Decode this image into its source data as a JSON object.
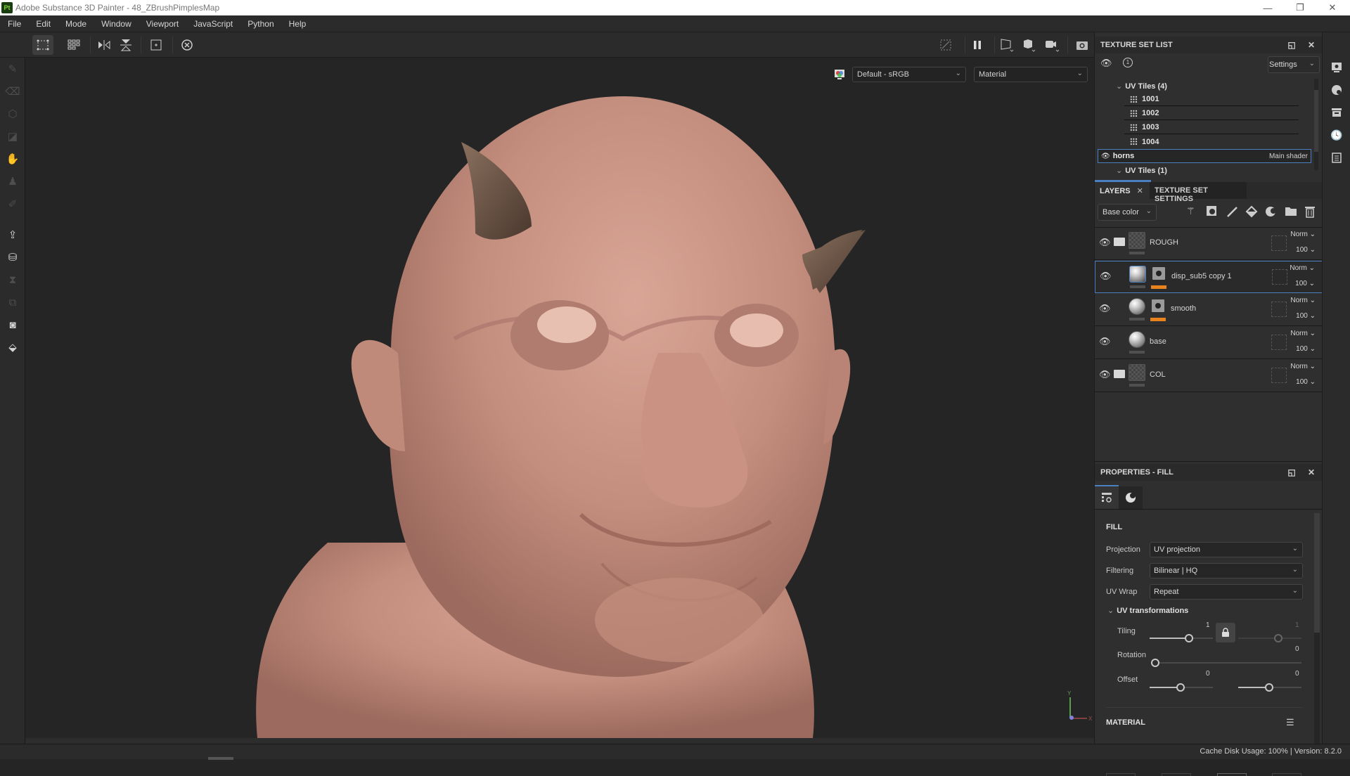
{
  "app": {
    "logo": "Pt",
    "title": "Adobe Substance 3D Painter - 48_ZBrushPimplesMap",
    "window_controls": {
      "minimize": "—",
      "maximize": "❐",
      "close": "✕"
    }
  },
  "menu": [
    "File",
    "Edit",
    "Mode",
    "Window",
    "Viewport",
    "JavaScript",
    "Python",
    "Help"
  ],
  "toolbar": {
    "left_icons": [
      "selection-mode-icon",
      "uv-tile-grid-icon",
      "symmetry-x-icon",
      "symmetry-y-icon",
      "center-view-icon",
      "history-reset-icon"
    ],
    "right_icons": [
      "hide-overlay-icon",
      "pause-icon",
      "display-mode-icon",
      "object-view-icon",
      "camera-icon",
      "screenshot-icon"
    ]
  },
  "left_tools": [
    "paint-brush",
    "eraser",
    "projection",
    "polygon-fill",
    "smudge",
    "clone-stamp",
    "color-picker",
    "export",
    "bake",
    "timeline",
    "transform",
    "sample",
    "geometry-mask"
  ],
  "viewport": {
    "color_profile": "Default - sRGB",
    "display_channel": "Material",
    "axis": {
      "y": "Y",
      "x": "X"
    }
  },
  "texture_set_list": {
    "title": "TEXTURE SET LIST",
    "settings_label": "Settings",
    "groups": [
      {
        "label": "UV Tiles (4)",
        "tiles": [
          "1001",
          "1002",
          "1003",
          "1004"
        ]
      }
    ],
    "selected_set": {
      "name": "horns",
      "shader": "Main shader"
    },
    "next_group": "UV Tiles (1)"
  },
  "layers_panel": {
    "tabs": [
      "LAYERS",
      "TEXTURE SET SETTINGS"
    ],
    "channel": "Base color",
    "tools": [
      "add-effect",
      "add-mask",
      "add-paint-layer",
      "add-fill-layer",
      "add-smart-material",
      "add-folder",
      "delete"
    ],
    "layers": [
      {
        "name": "ROUGH",
        "type": "folder",
        "blend": "Norm",
        "opacity": "100",
        "selected": false
      },
      {
        "name": "disp_sub5 copy 1",
        "type": "fill-mask",
        "blend": "Norm",
        "opacity": "100",
        "selected": true
      },
      {
        "name": "smooth",
        "type": "fill-mask",
        "blend": "Norm",
        "opacity": "100",
        "selected": false
      },
      {
        "name": "base",
        "type": "fill",
        "blend": "Norm",
        "opacity": "100",
        "selected": false
      },
      {
        "name": "COL",
        "type": "folder",
        "blend": "Norm",
        "opacity": "100",
        "selected": false
      }
    ]
  },
  "properties": {
    "title": "PROPERTIES - FILL",
    "section": "FILL",
    "fields": [
      {
        "label": "Projection",
        "value": "UV projection"
      },
      {
        "label": "Filtering",
        "value": "Bilinear | HQ"
      },
      {
        "label": "UV Wrap",
        "value": "Repeat"
      }
    ],
    "uv_transformations": {
      "label": "UV transformations",
      "tiling_label": "Tiling",
      "tiling_u": "1",
      "tiling_v": "1",
      "rotation_label": "Rotation",
      "rotation": "0",
      "offset_label": "Offset",
      "offset_u": "0",
      "offset_v": "0"
    },
    "material_section": "MATERIAL"
  },
  "status": {
    "text": "Cache Disk Usage: 100% | Version: 8.2.0"
  },
  "colors": {
    "accent_blue": "#4a7fc1",
    "mask_orange": "#e7821d",
    "skin": "#c89484",
    "horn": "#6e5646"
  }
}
